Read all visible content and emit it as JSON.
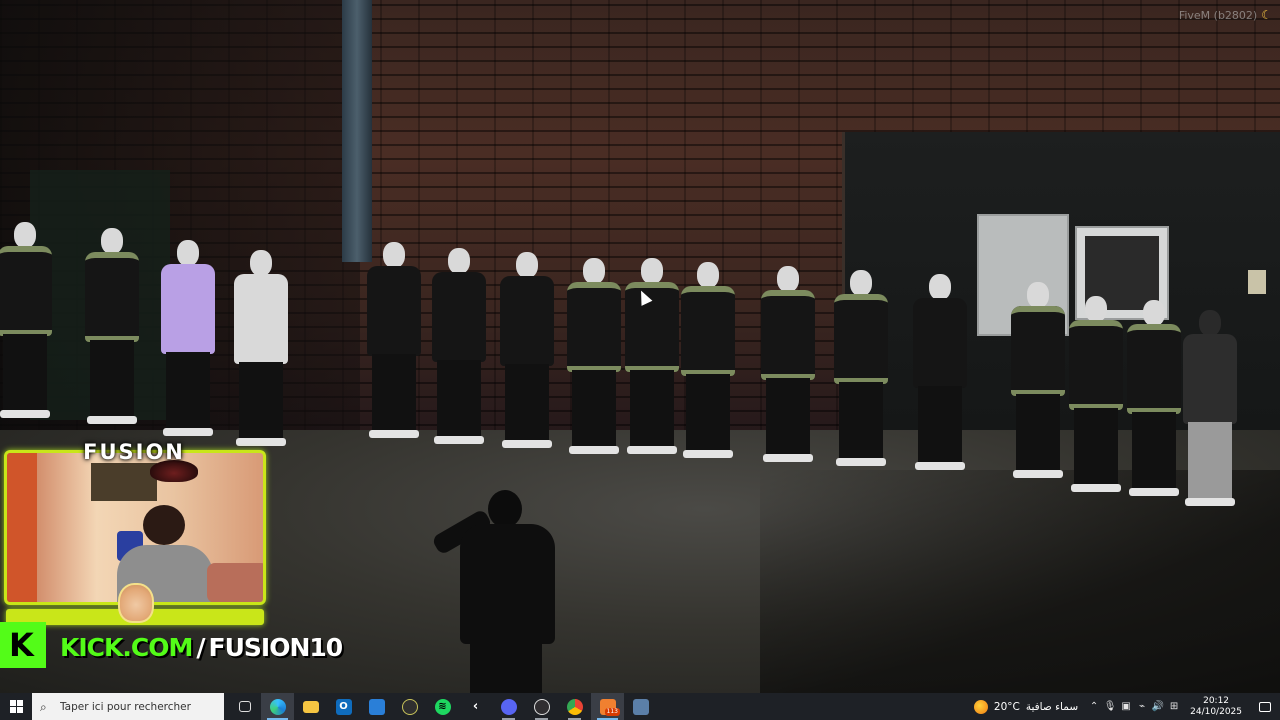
{
  "game": {
    "watermark": "FiveM (b2802)"
  },
  "overlay": {
    "streamer_logo": "FUSION",
    "kick_domain": "KICK.COM",
    "kick_separator": "/",
    "kick_username": "FUSION10",
    "kick_letter": "K",
    "progress_fraction": 1.0,
    "accent_color": "#c9e619",
    "kick_color": "#53fc18"
  },
  "taskbar": {
    "search_placeholder": "Taper ici pour rechercher",
    "apps": [
      {
        "name": "task-view",
        "icon": "task-view-icon"
      },
      {
        "name": "edge",
        "icon": "edge-icon",
        "active": true
      },
      {
        "name": "file-explorer",
        "icon": "folder-icon"
      },
      {
        "name": "outlook",
        "icon": "outlook-icon"
      },
      {
        "name": "store",
        "icon": "store-icon"
      },
      {
        "name": "xbox",
        "icon": "xbox-icon"
      },
      {
        "name": "spotify",
        "icon": "spotify-icon"
      },
      {
        "name": "kick-app",
        "icon": "app-icon"
      },
      {
        "name": "discord",
        "icon": "discord-icon"
      },
      {
        "name": "obs",
        "icon": "obs-icon"
      },
      {
        "name": "chrome",
        "icon": "chrome-icon"
      },
      {
        "name": "fivem",
        "icon": "fivem-icon",
        "badge": "113"
      },
      {
        "name": "calculator",
        "icon": "calculator-icon"
      }
    ],
    "weather": {
      "temperature": "20°C",
      "condition": "سماء صافية"
    },
    "clock": {
      "time": "20:12",
      "date": "24/10/2025"
    }
  }
}
